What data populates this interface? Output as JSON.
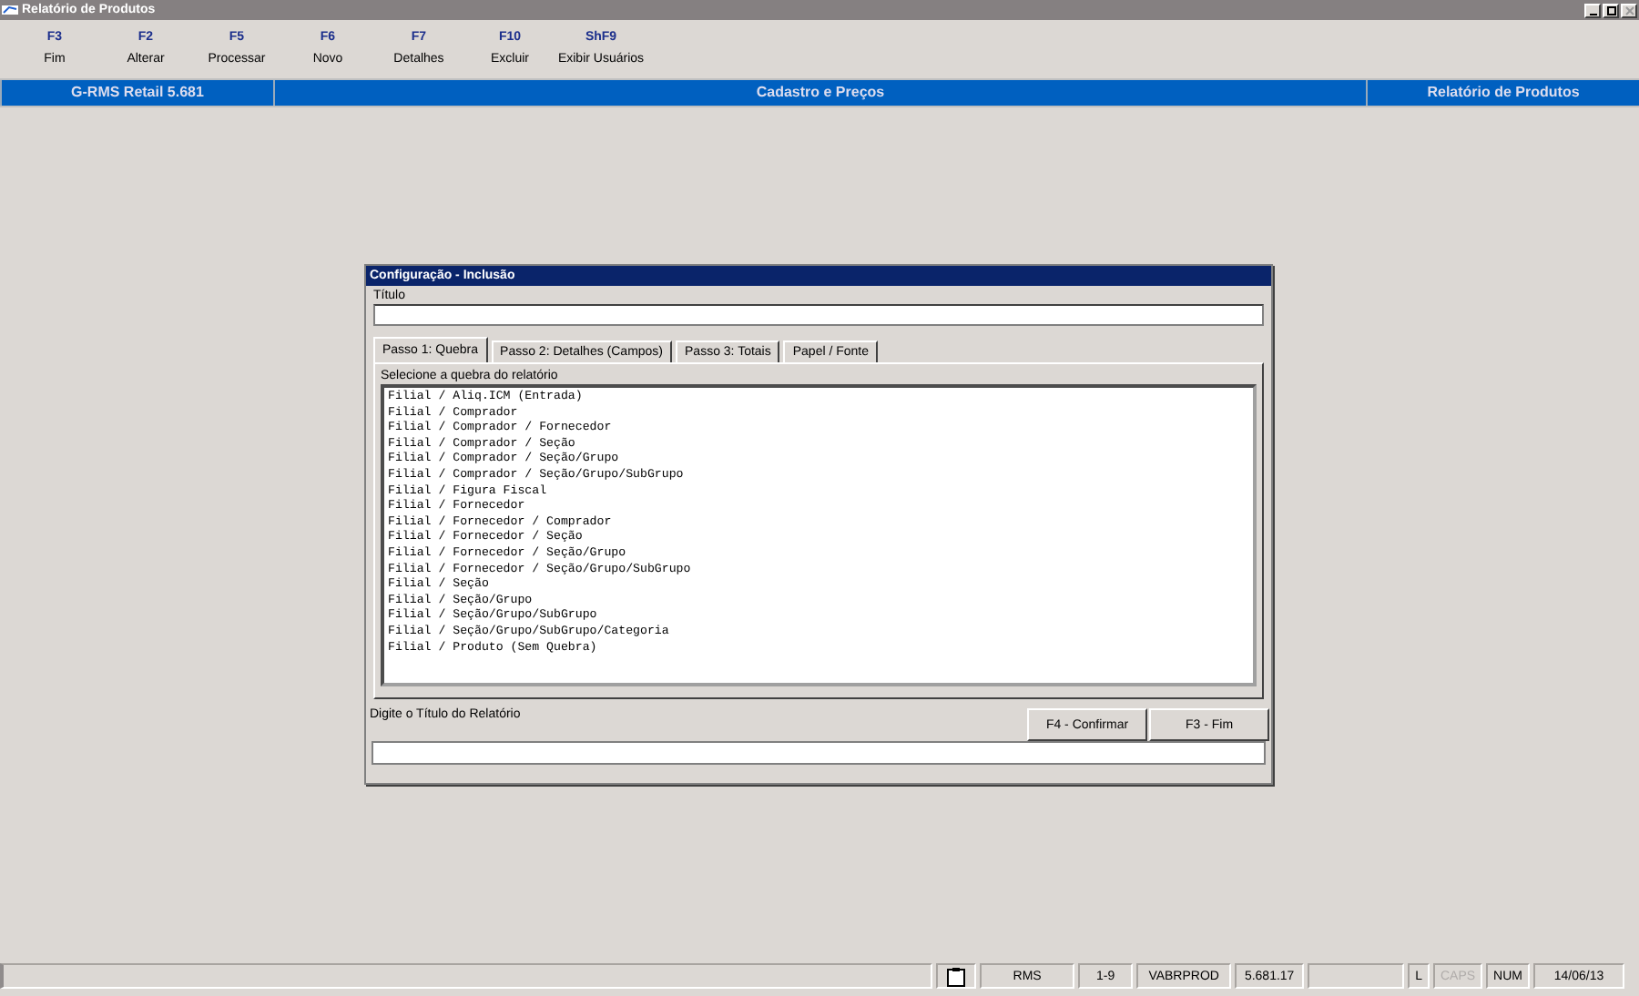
{
  "window": {
    "title": "Relatório de Produtos"
  },
  "toolbar": [
    {
      "key": "F3",
      "label": "Fim"
    },
    {
      "key": "F2",
      "label": "Alterar"
    },
    {
      "key": "F5",
      "label": "Processar"
    },
    {
      "key": "F6",
      "label": "Novo"
    },
    {
      "key": "F7",
      "label": "Detalhes"
    },
    {
      "key": "F10",
      "label": "Excluir"
    },
    {
      "key": "ShF9",
      "label": "Exibir Usuários"
    }
  ],
  "header": {
    "app": "G-RMS Retail 5.681",
    "module": "Cadastro e Preços",
    "screen": "Relatório de Produtos"
  },
  "dialog": {
    "title": "Configuração - Inclusão",
    "title_label": "Título",
    "tabs": [
      {
        "label": "Passo 1: Quebra",
        "selected": true
      },
      {
        "label": "Passo 2: Detalhes (Campos)",
        "selected": false
      },
      {
        "label": "Passo 3: Totais",
        "selected": false
      },
      {
        "label": "Papel / Fonte",
        "selected": false
      }
    ],
    "list_label": "Selecione a quebra do relatório",
    "items": [
      "Filial / Aliq.ICM (Entrada)",
      "Filial / Comprador",
      "Filial / Comprador / Fornecedor",
      "Filial / Comprador / Seção",
      "Filial / Comprador / Seção/Grupo",
      "Filial / Comprador / Seção/Grupo/SubGrupo",
      "Filial / Figura Fiscal",
      "Filial / Fornecedor",
      "Filial / Fornecedor / Comprador",
      "Filial / Fornecedor / Seção",
      "Filial / Fornecedor / Seção/Grupo",
      "Filial / Fornecedor / Seção/Grupo/SubGrupo",
      "Filial / Seção",
      "Filial / Seção/Grupo",
      "Filial / Seção/Grupo/SubGrupo",
      "Filial / Seção/Grupo/SubGrupo/Categoria",
      "Filial / Produto (Sem Quebra)"
    ],
    "hint": "Digite o Título do Relatório",
    "buttons": [
      "F4 - Confirmar",
      "F3 - Fim"
    ]
  },
  "status_bar": {
    "cells": [
      "RMS",
      "1-9",
      "VABRPROD",
      "5.681.17"
    ],
    "indicators": [
      {
        "label": "L",
        "on": true
      },
      {
        "label": "CAPS",
        "on": false
      },
      {
        "label": "NUM",
        "on": true
      }
    ],
    "date": "14/06/13"
  }
}
